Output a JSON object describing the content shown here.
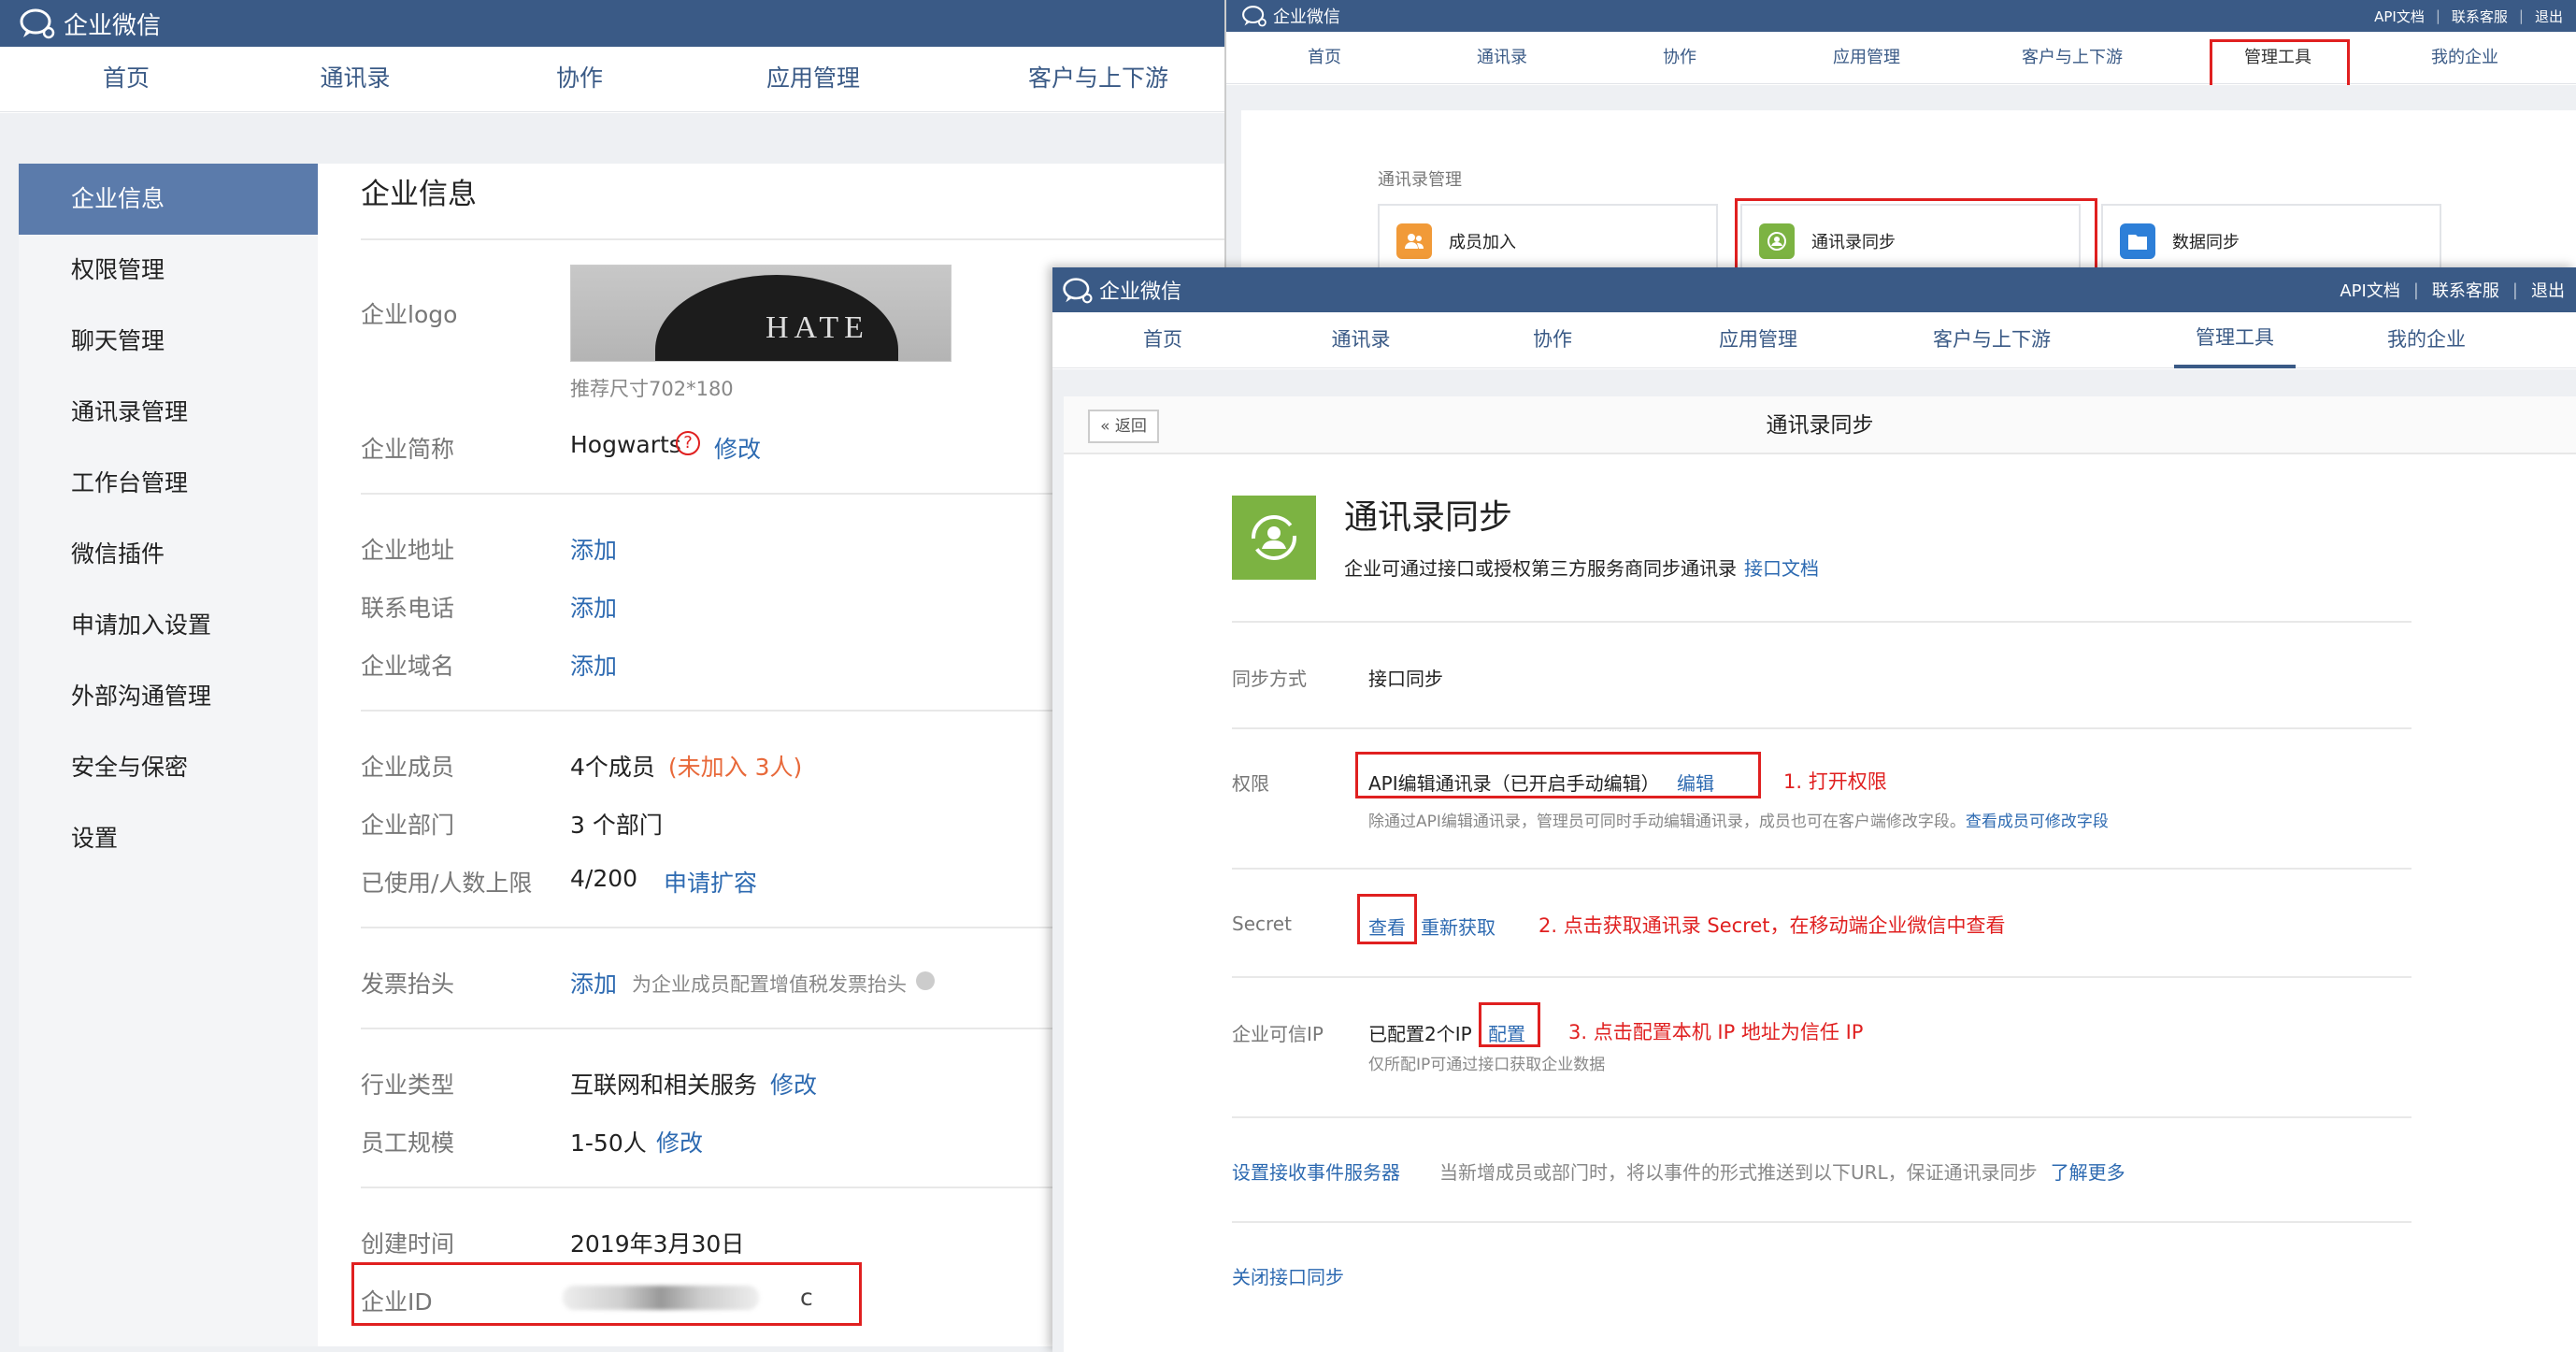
{
  "brand": "企业微信",
  "win1": {
    "nav": [
      "首页",
      "通讯录",
      "协作",
      "应用管理",
      "客户与上下游"
    ],
    "sidebar": [
      "企业信息",
      "权限管理",
      "聊天管理",
      "通讯录管理",
      "工作台管理",
      "微信插件",
      "申请加入设置",
      "外部沟通管理",
      "安全与保密",
      "设置"
    ],
    "title": "企业信息",
    "logo_label": "企业logo",
    "logo_text": "HATE",
    "logo_hint": "推荐尺寸702*180",
    "short_name_label": "企业简称",
    "short_name": "Hogwarts",
    "help_mark": "?",
    "modify": "修改",
    "address_label": "企业地址",
    "phone_label": "联系电话",
    "domain_label": "企业域名",
    "add": "添加",
    "members_label": "企业成员",
    "members_value": "4个成员",
    "members_note": "(未加入 3人)",
    "dept_label": "企业部门",
    "dept_value": "3 个部门",
    "limit_label": "已使用/人数上限",
    "limit_value": "4/200",
    "expand": "申请扩容",
    "invoice_label": "发票抬头",
    "invoice_hint": "为企业成员配置增值税发票抬头",
    "industry_label": "行业类型",
    "industry_value": "互联网和相关服务",
    "scale_label": "员工规模",
    "scale_value": "1-50人",
    "created_label": "创建时间",
    "created_value": "2019年3月30日",
    "corpid_label": "企业ID",
    "corpid_tail": "c"
  },
  "win2": {
    "toplinks": [
      "API文档",
      "联系客服",
      "退出"
    ],
    "nav": [
      "首页",
      "通讯录",
      "协作",
      "应用管理",
      "客户与上下游",
      "管理工具",
      "我的企业"
    ],
    "section": "通讯录管理",
    "cards": [
      "成员加入",
      "通讯录同步",
      "数据同步"
    ]
  },
  "win3": {
    "toplinks": [
      "API文档",
      "联系客服",
      "退出"
    ],
    "nav": [
      "首页",
      "通讯录",
      "协作",
      "应用管理",
      "客户与上下游",
      "管理工具",
      "我的企业"
    ],
    "back": "返回",
    "header": "通讯录同步",
    "title": "通讯录同步",
    "desc": "企业可通过接口或授权第三方服务商同步通讯录",
    "api_doc": "接口文档",
    "sync_mode_label": "同步方式",
    "sync_mode": "接口同步",
    "perm_label": "权限",
    "perm_value": "API编辑通讯录（已开启手动编辑）",
    "edit": "编辑",
    "step1": "1. 打开权限",
    "perm_note": "除通过API编辑通讯录，管理员可同时手动编辑通讯录，成员也可在客户端修改字段。",
    "perm_note_link": "查看成员可修改字段",
    "secret_label": "Secret",
    "view": "查看",
    "refetch": "重新获取",
    "step2": "2. 点击获取通讯录 Secret，在移动端企业微信中查看",
    "ip_label": "企业可信IP",
    "ip_value": "已配置2个IP",
    "config": "配置",
    "step3": "3. 点击配置本机 IP 地址为信任 IP",
    "ip_note": "仅所配IP可通过接口获取企业数据",
    "event_link": "设置接收事件服务器",
    "event_desc": "当新增成员或部门时，将以事件的形式推送到以下URL，保证通讯录同步",
    "learn_more": "了解更多",
    "close_sync": "关闭接口同步"
  },
  "colors": {
    "topbar": "#3a5a86",
    "link": "#2d6ab1",
    "red": "#e02020",
    "green": "#7cb342",
    "orange": "#f19a38",
    "blue": "#2d7fd8"
  }
}
